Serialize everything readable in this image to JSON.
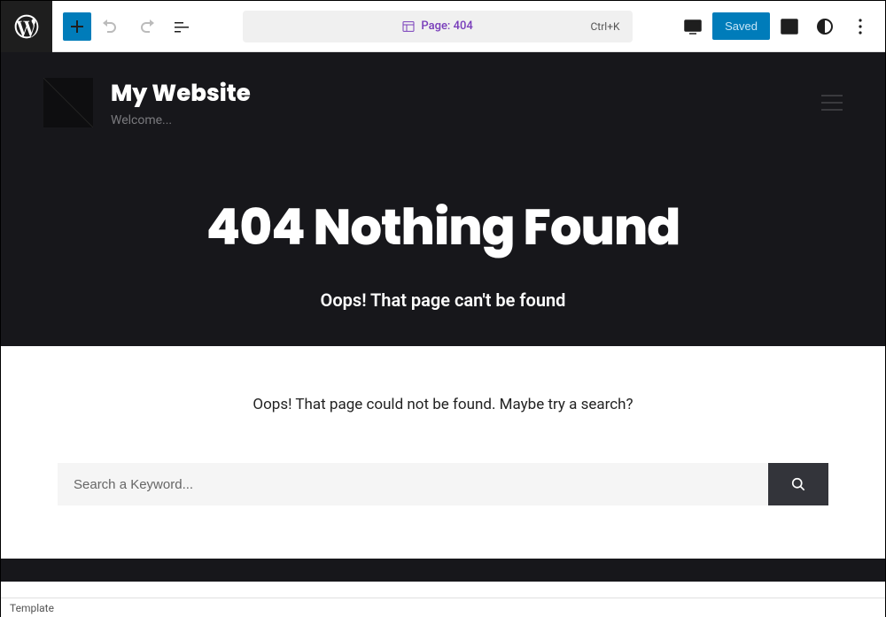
{
  "toolbar": {
    "document_label": "Page: 404",
    "shortcut": "Ctrl+K",
    "saved_label": "Saved"
  },
  "site": {
    "title": "My Website",
    "tagline": "Welcome..."
  },
  "hero": {
    "heading": "404 Nothing Found",
    "subheading": "Oops! That page can't be found"
  },
  "content": {
    "help_text": "Oops! That page could not be found. Maybe try a search?",
    "search_placeholder": "Search a Keyword..."
  },
  "status": {
    "label": "Template"
  }
}
